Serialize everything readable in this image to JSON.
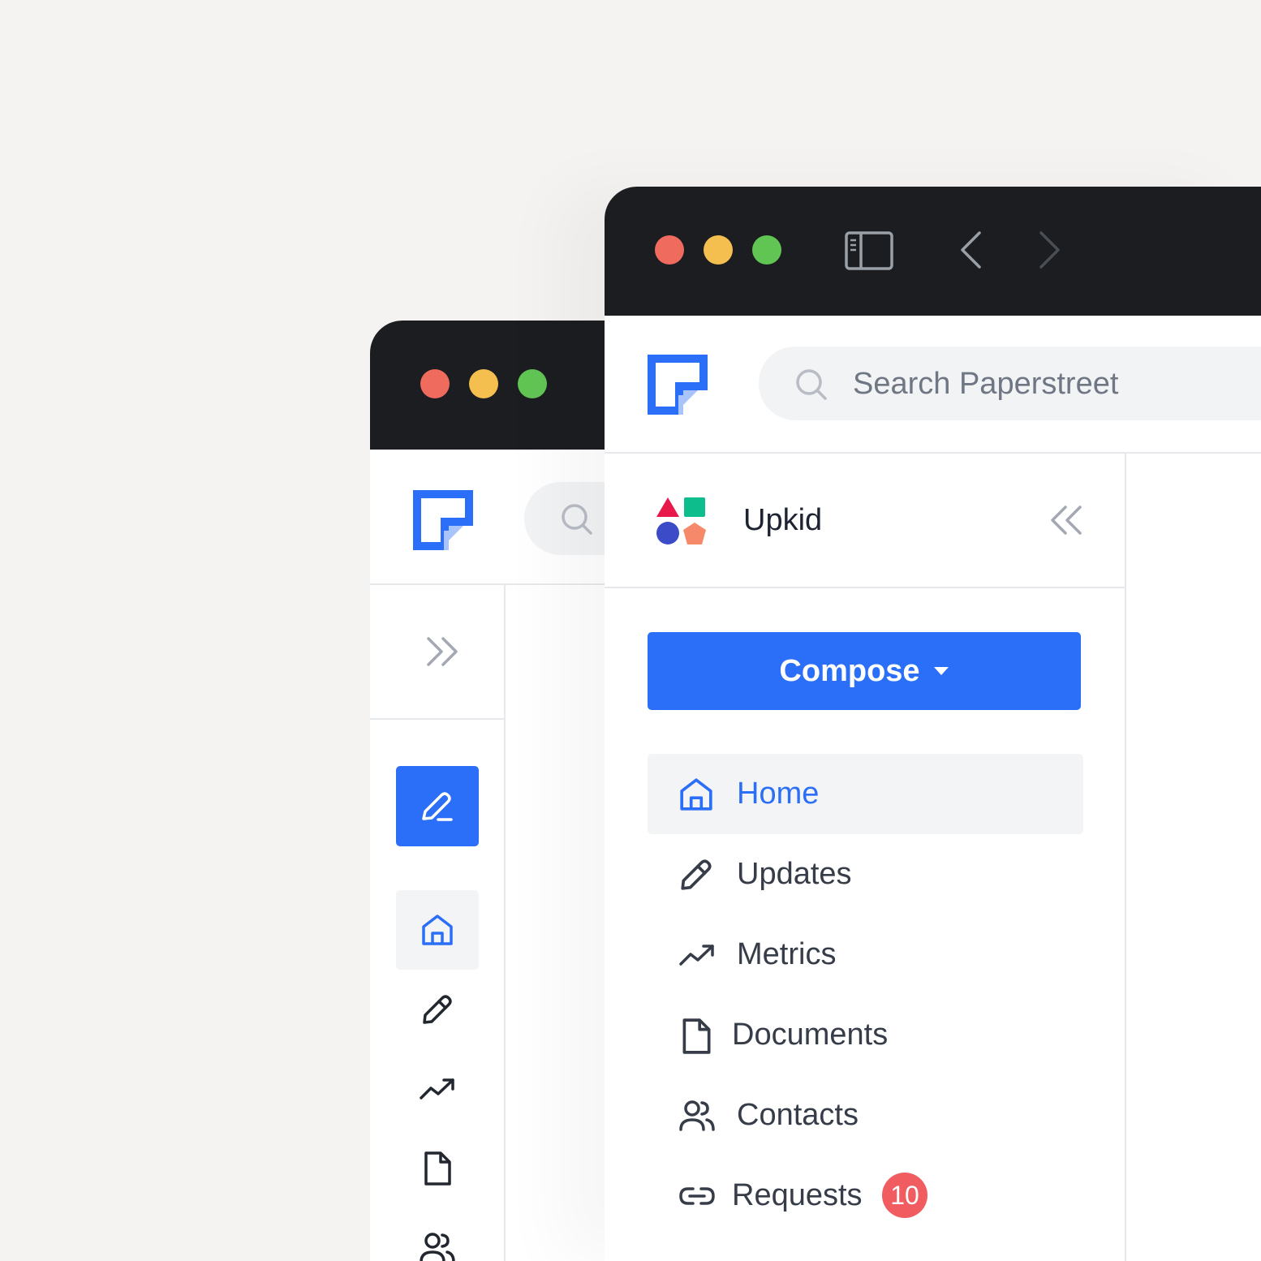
{
  "back_window": {
    "rail_items": [
      {
        "name": "home",
        "icon": "home-icon",
        "active": true
      },
      {
        "name": "updates",
        "icon": "pencil-icon"
      },
      {
        "name": "metrics",
        "icon": "trending-up-icon"
      },
      {
        "name": "documents",
        "icon": "document-icon"
      },
      {
        "name": "contacts",
        "icon": "users-icon"
      }
    ]
  },
  "front_window": {
    "search": {
      "placeholder": "Search Paperstreet"
    },
    "workspace": {
      "name": "Upkid"
    },
    "compose": {
      "label": "Compose"
    },
    "nav": [
      {
        "label": "Home",
        "icon": "home-icon",
        "active": true
      },
      {
        "label": "Updates",
        "icon": "pencil-icon"
      },
      {
        "label": "Metrics",
        "icon": "trending-up-icon"
      },
      {
        "label": "Documents",
        "icon": "document-icon"
      },
      {
        "label": "Contacts",
        "icon": "users-icon"
      },
      {
        "label": "Requests",
        "icon": "link-icon",
        "badge": "10"
      }
    ]
  },
  "colors": {
    "accent": "#2b6ef7",
    "titlebar": "#1b1d20",
    "badge": "#f15c60",
    "traffic_red": "#ee6b5e",
    "traffic_yellow": "#f4bf4f",
    "traffic_green": "#61c554"
  }
}
